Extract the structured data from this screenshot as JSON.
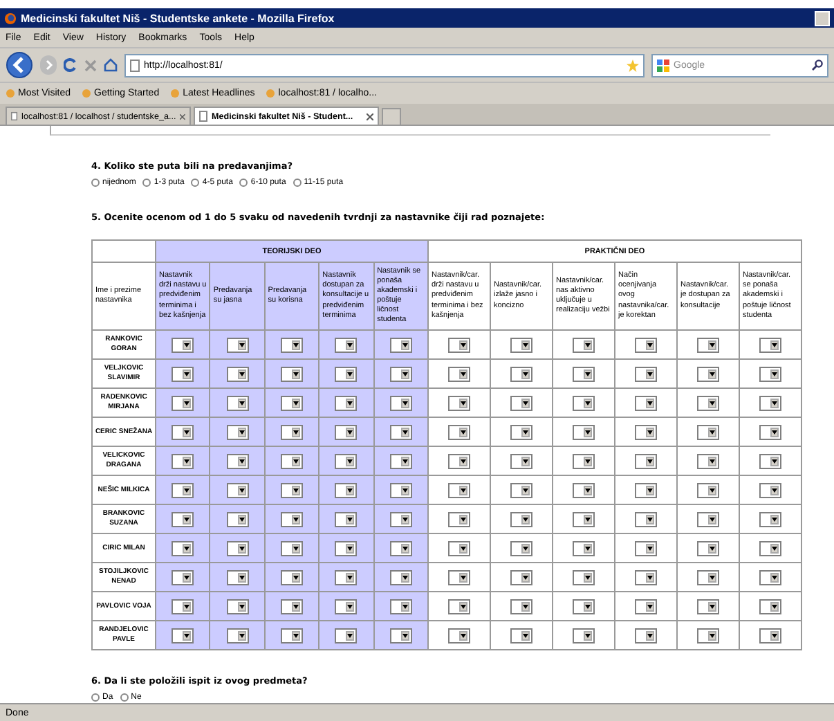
{
  "window": {
    "title": "Medicinski fakultet Niš - Studentske ankete - Mozilla Firefox"
  },
  "menu": [
    "File",
    "Edit",
    "View",
    "History",
    "Bookmarks",
    "Tools",
    "Help"
  ],
  "toolbar": {
    "url": "http://localhost:81/",
    "search_placeholder": "Google"
  },
  "bookmarks": [
    "Most Visited",
    "Getting Started",
    "Latest Headlines",
    "localhost:81 / localho..."
  ],
  "tabs": [
    {
      "label": "localhost:81 / localhost / studentske_a...",
      "selected": false
    },
    {
      "label": "Medicinski fakultet Niš - Student...",
      "selected": true
    }
  ],
  "question_4": {
    "text": "4. Koliko ste puta bili na predavanjima?",
    "options": [
      {
        "label": "nijednom",
        "selected": false
      },
      {
        "label": "1-3 puta",
        "selected": false
      },
      {
        "label": "4-5 puta",
        "selected": false
      },
      {
        "label": "6-10 puta",
        "selected": false
      },
      {
        "label": "11-15 puta",
        "selected": false
      }
    ]
  },
  "question_5": {
    "text": "5. Ocenite ocenom od 1 do 5 svaku od navedenih tvrdnji za nastavnike čiji rad poznajete:"
  },
  "table": {
    "theory_group": "TEORIJSKI DEO",
    "practical_group": "PRAKTIČNI DEO",
    "name_header": "Ime i prezime nastavnika",
    "theory_columns": [
      "Nastavnik drži nastavu u predviđenim terminima i bez kašnjenja",
      "Predavanja su jasna",
      "Predavanja su korisna",
      "Nastavnik dostupan za konsultacije u predviđenim terminima",
      "Nastavnik se ponaša akademski i poštuje ličnost studenta"
    ],
    "practical_columns": [
      "Nastavnik/car. drži nastavu u predviđenim terminima i bez kašnjenja",
      "Nastavnik/car. izlaže jasno i koncizno",
      "Nastavnik/car. nas aktivno uključuje u realizaciju vežbi",
      "Način ocenjivanja ovog nastavnika/car. je korektan",
      "Nastavnik/car. je dostupan za konsultacije",
      "Nastavnik/car. se ponaša akademski i poštuje ličnost studenta"
    ],
    "rows": [
      {
        "name": "RANKOVIC GORAN"
      },
      {
        "name": "VELJKOVIC SLAVIMIR"
      },
      {
        "name": "RADENKOVIC MIRJANA"
      },
      {
        "name": "CERIC SNEŽANA"
      },
      {
        "name": "VELICKOVIC DRAGANA"
      },
      {
        "name": "NEŠIC MILKICA"
      },
      {
        "name": "BRANKOVIC SUZANA"
      },
      {
        "name": "CIRIC MILAN"
      },
      {
        "name": "STOJILJKOVIC NENAD"
      },
      {
        "name": "PAVLOVIC VOJA"
      },
      {
        "name": "RANDJELOVIC PAVLE"
      }
    ]
  },
  "question_6": {
    "text": "6. Da li ste položili ispit iz ovog predmeta?",
    "options": [
      {
        "label": "Da",
        "selected": false
      },
      {
        "label": "Ne",
        "selected": false
      }
    ]
  },
  "status_bar": "Done"
}
